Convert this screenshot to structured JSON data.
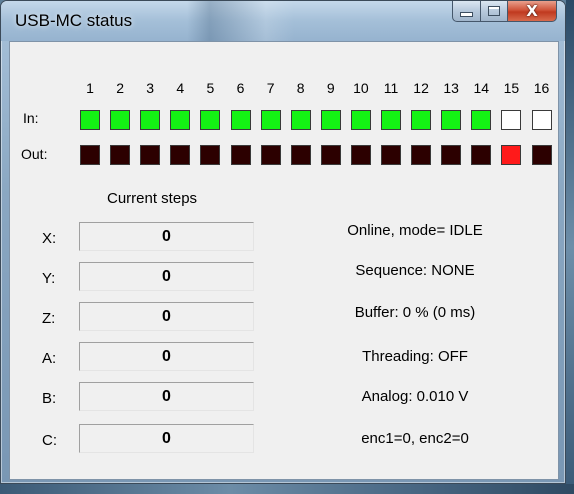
{
  "window": {
    "title": "USB-MC status",
    "close_glyph": "X"
  },
  "io": {
    "channels": [
      "1",
      "2",
      "3",
      "4",
      "5",
      "6",
      "7",
      "8",
      "9",
      "10",
      "11",
      "12",
      "13",
      "14",
      "15",
      "16"
    ],
    "in_label": "In:",
    "out_label": "Out:",
    "inputs": [
      true,
      true,
      true,
      true,
      true,
      true,
      true,
      true,
      true,
      true,
      true,
      true,
      true,
      true,
      false,
      false
    ],
    "outputs": [
      false,
      false,
      false,
      false,
      false,
      false,
      false,
      false,
      false,
      false,
      false,
      false,
      false,
      false,
      true,
      false
    ],
    "colors": {
      "input_on": "#14f214",
      "input_off": "#ffffff",
      "output_off": "#2c0000",
      "output_on": "#ff1a1a"
    }
  },
  "steps": {
    "heading": "Current steps",
    "axes": [
      {
        "label": "X:",
        "value": "0"
      },
      {
        "label": "Y:",
        "value": "0"
      },
      {
        "label": "Z:",
        "value": "0"
      },
      {
        "label": "A:",
        "value": "0"
      },
      {
        "label": "B:",
        "value": "0"
      },
      {
        "label": "C:",
        "value": "0"
      }
    ]
  },
  "status": {
    "lines": [
      "Online, mode= IDLE",
      "Sequence: NONE",
      "Buffer: 0 % (0 ms)",
      "Threading: OFF",
      "Analog: 0.010 V",
      "enc1=0, enc2=0"
    ]
  }
}
